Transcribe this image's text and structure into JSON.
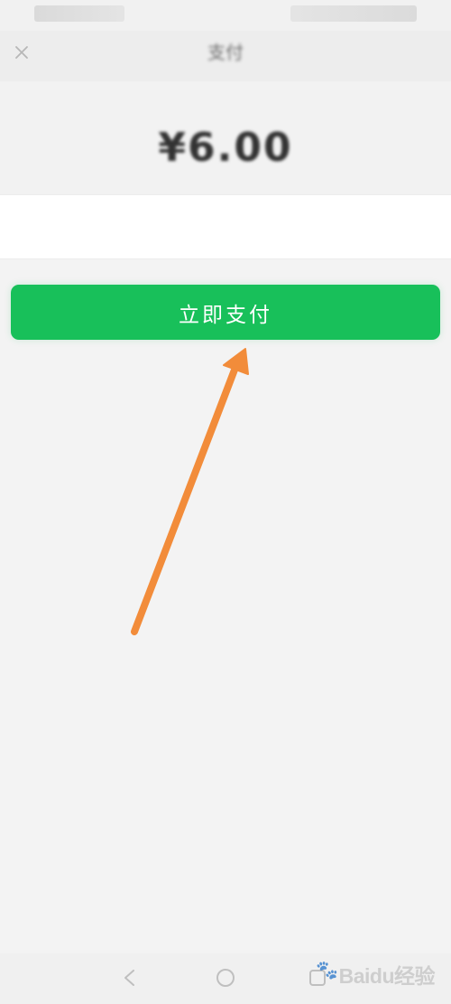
{
  "status_bar": {
    "left_text": "",
    "right_text": ""
  },
  "header": {
    "title": "支付",
    "close_icon": "close-icon"
  },
  "payment": {
    "merchant": "",
    "amount": "¥6.00"
  },
  "method": {
    "label": "",
    "value": ""
  },
  "action": {
    "pay_label": "立即支付",
    "button_color": "#18c05a"
  },
  "footer": {
    "note": ""
  },
  "nav": {
    "back_icon": "back-icon",
    "home_icon": "home-icon",
    "recent_icon": "recent-apps-icon"
  },
  "watermark": {
    "text": "Baidu经验"
  },
  "annotation": {
    "arrow_color": "#f28c3a"
  }
}
